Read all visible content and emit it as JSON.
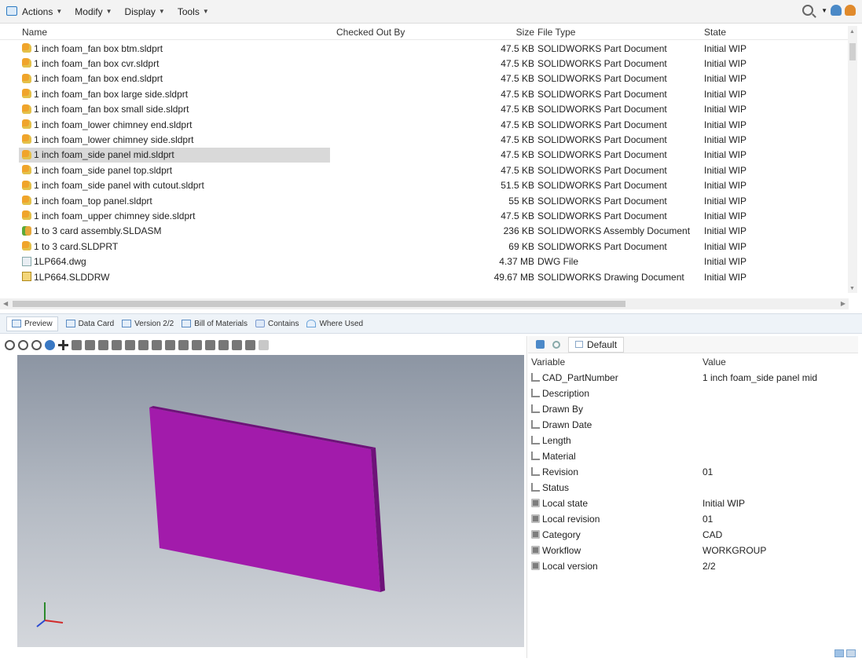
{
  "toolbar": {
    "menus": [
      {
        "label": "Actions"
      },
      {
        "label": "Modify"
      },
      {
        "label": "Display"
      },
      {
        "label": "Tools"
      }
    ]
  },
  "file_list": {
    "headers": {
      "name": "Name",
      "checked_out_by": "Checked Out By",
      "size": "Size",
      "file_type": "File Type",
      "state": "State"
    },
    "rows": [
      {
        "name": "1 inch foam_fan box btm.sldprt",
        "checked_out_by": "",
        "size": "47.5 KB",
        "file_type": "SOLIDWORKS Part Document",
        "state": "Initial WIP",
        "icon": "part-icon"
      },
      {
        "name": "1 inch foam_fan box cvr.sldprt",
        "checked_out_by": "",
        "size": "47.5 KB",
        "file_type": "SOLIDWORKS Part Document",
        "state": "Initial WIP",
        "icon": "part-icon"
      },
      {
        "name": "1 inch foam_fan box end.sldprt",
        "checked_out_by": "",
        "size": "47.5 KB",
        "file_type": "SOLIDWORKS Part Document",
        "state": "Initial WIP",
        "icon": "part-icon"
      },
      {
        "name": "1 inch foam_fan box large side.sldprt",
        "checked_out_by": "",
        "size": "47.5 KB",
        "file_type": "SOLIDWORKS Part Document",
        "state": "Initial WIP",
        "icon": "part-icon"
      },
      {
        "name": "1 inch foam_fan box small side.sldprt",
        "checked_out_by": "",
        "size": "47.5 KB",
        "file_type": "SOLIDWORKS Part Document",
        "state": "Initial WIP",
        "icon": "part-icon"
      },
      {
        "name": "1 inch foam_lower chimney end.sldprt",
        "checked_out_by": "",
        "size": "47.5 KB",
        "file_type": "SOLIDWORKS Part Document",
        "state": "Initial WIP",
        "icon": "part-icon"
      },
      {
        "name": "1 inch foam_lower chimney side.sldprt",
        "checked_out_by": "",
        "size": "47.5 KB",
        "file_type": "SOLIDWORKS Part Document",
        "state": "Initial WIP",
        "icon": "part-icon"
      },
      {
        "name": "1 inch foam_side panel mid.sldprt",
        "checked_out_by": "",
        "size": "47.5 KB",
        "file_type": "SOLIDWORKS Part Document",
        "state": "Initial WIP",
        "icon": "part-icon",
        "selected": true
      },
      {
        "name": "1 inch foam_side panel top.sldprt",
        "checked_out_by": "",
        "size": "47.5 KB",
        "file_type": "SOLIDWORKS Part Document",
        "state": "Initial WIP",
        "icon": "part-icon"
      },
      {
        "name": "1 inch foam_side panel with cutout.sldprt",
        "checked_out_by": "",
        "size": "51.5 KB",
        "file_type": "SOLIDWORKS Part Document",
        "state": "Initial WIP",
        "icon": "part-icon"
      },
      {
        "name": "1 inch foam_top panel.sldprt",
        "checked_out_by": "",
        "size": "55 KB",
        "file_type": "SOLIDWORKS Part Document",
        "state": "Initial WIP",
        "icon": "part-icon"
      },
      {
        "name": "1 inch foam_upper chimney side.sldprt",
        "checked_out_by": "",
        "size": "47.5 KB",
        "file_type": "SOLIDWORKS Part Document",
        "state": "Initial WIP",
        "icon": "part-icon"
      },
      {
        "name": "1 to 3 card assembly.SLDASM",
        "checked_out_by": "",
        "size": "236 KB",
        "file_type": "SOLIDWORKS Assembly Document",
        "state": "Initial WIP",
        "icon": "assembly-icon"
      },
      {
        "name": "1 to 3 card.SLDPRT",
        "checked_out_by": "",
        "size": "69 KB",
        "file_type": "SOLIDWORKS Part Document",
        "state": "Initial WIP",
        "icon": "part-icon"
      },
      {
        "name": "1LP664.dwg",
        "checked_out_by": "",
        "size": "4.37 MB",
        "file_type": "DWG File",
        "state": "Initial WIP",
        "icon": "dwg-icon"
      },
      {
        "name": "1LP664.SLDDRW",
        "checked_out_by": "",
        "size": "49.67 MB",
        "file_type": "SOLIDWORKS Drawing Document",
        "state": "Initial WIP",
        "icon": "drawing-icon"
      }
    ]
  },
  "preview_tabs": [
    {
      "label": "Preview",
      "active": true
    },
    {
      "label": "Data Card"
    },
    {
      "label": "Version 2/2"
    },
    {
      "label": "Bill of Materials"
    },
    {
      "label": "Contains"
    },
    {
      "label": "Where Used"
    }
  ],
  "properties": {
    "configuration_tab": "Default",
    "headers": {
      "variable": "Variable",
      "value": "Value"
    },
    "rows": [
      {
        "variable": "CAD_PartNumber",
        "value": "1 inch foam_side panel mid",
        "icon": "attr"
      },
      {
        "variable": "Description",
        "value": "",
        "icon": "attr"
      },
      {
        "variable": "Drawn By",
        "value": "",
        "icon": "attr"
      },
      {
        "variable": "Drawn Date",
        "value": "",
        "icon": "attr"
      },
      {
        "variable": "Length",
        "value": "",
        "icon": "attr"
      },
      {
        "variable": "Material",
        "value": "",
        "icon": "attr"
      },
      {
        "variable": "Revision",
        "value": "01",
        "icon": "attr"
      },
      {
        "variable": "Status",
        "value": "",
        "icon": "attr"
      },
      {
        "variable": "Local state",
        "value": "Initial WIP",
        "icon": "sys"
      },
      {
        "variable": "Local revision",
        "value": "01",
        "icon": "sys"
      },
      {
        "variable": "Category",
        "value": "CAD",
        "icon": "sys"
      },
      {
        "variable": "Workflow",
        "value": "WORKGROUP",
        "icon": "sys"
      },
      {
        "variable": "Local version",
        "value": "2/2",
        "icon": "sys"
      }
    ]
  },
  "colors": {
    "part_model": "#a21bab",
    "part_model_edge": "#6e1279",
    "selection": "#d9d9d9"
  }
}
